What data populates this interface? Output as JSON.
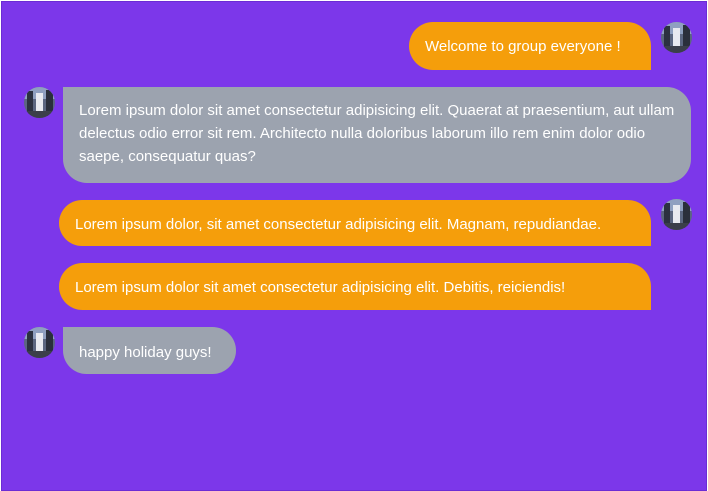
{
  "chat": {
    "messages": [
      {
        "sender": "me",
        "text": "Welcome to group everyone !"
      },
      {
        "sender": "other",
        "text": "Lorem ipsum dolor sit amet consectetur adipisicing elit. Quaerat at praesentium, aut ullam delectus odio error sit rem. Architecto nulla doloribus laborum illo rem enim dolor odio saepe, consequatur quas?"
      },
      {
        "sender": "me",
        "text": "Lorem ipsum dolor, sit amet consectetur adipisicing elit. Magnam, repudiandae."
      },
      {
        "sender": "me",
        "text": "Lorem ipsum dolor sit amet consectetur adipisicing elit. Debitis, reiciendis!"
      },
      {
        "sender": "other",
        "text": "happy holiday guys!"
      }
    ]
  },
  "colors": {
    "background": "#7c37ea",
    "sent_bubble": "#f59e0b",
    "received_bubble": "#9ca3af",
    "text": "#ffffff"
  },
  "icons": {
    "avatar": "user-avatar-icon"
  }
}
